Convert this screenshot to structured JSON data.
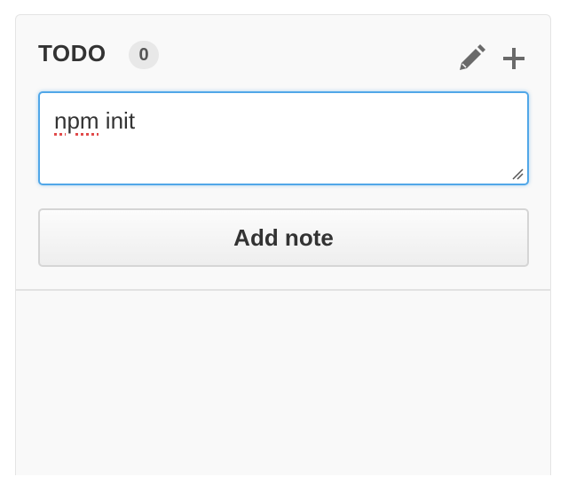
{
  "column": {
    "title": "TODO",
    "count": "0"
  },
  "icons": {
    "edit": "pencil-icon",
    "add": "plus-icon"
  },
  "note_form": {
    "value_misspelled_word": "npm",
    "value_rest": " init",
    "submit_label": "Add note"
  },
  "colors": {
    "focus_border": "#51a7e8",
    "spellcheck_underline": "#e14b4b",
    "column_bg": "#f9f9f9"
  }
}
